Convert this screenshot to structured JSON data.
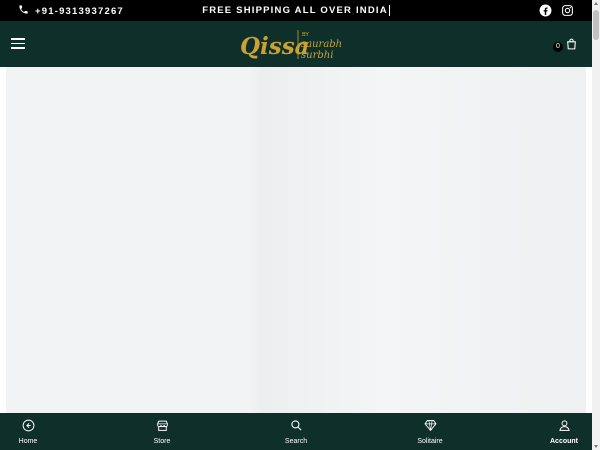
{
  "topbar": {
    "phone": "+91-9313937267",
    "shipping_text": "FREE SHIPPING ALL OVER INDIA",
    "social": [
      {
        "icon": "facebook-icon"
      },
      {
        "icon": "instagram-icon"
      }
    ]
  },
  "header": {
    "logo": {
      "main": "Qissa",
      "by": "BY",
      "line1": "saurabh",
      "line2": "surbhi"
    },
    "cart_count": "0"
  },
  "bottom_nav": [
    {
      "label": "Home",
      "icon": "back-circle-icon"
    },
    {
      "label": "Store",
      "icon": "store-icon"
    },
    {
      "label": "Search",
      "icon": "search-icon"
    },
    {
      "label": "Solitaire",
      "icon": "diamond-icon"
    },
    {
      "label": "Account",
      "icon": "user-icon"
    }
  ],
  "colors": {
    "topbar_bg": "#000000",
    "header_bg": "#0e2f2a",
    "logo_gold": "#c9a233"
  }
}
